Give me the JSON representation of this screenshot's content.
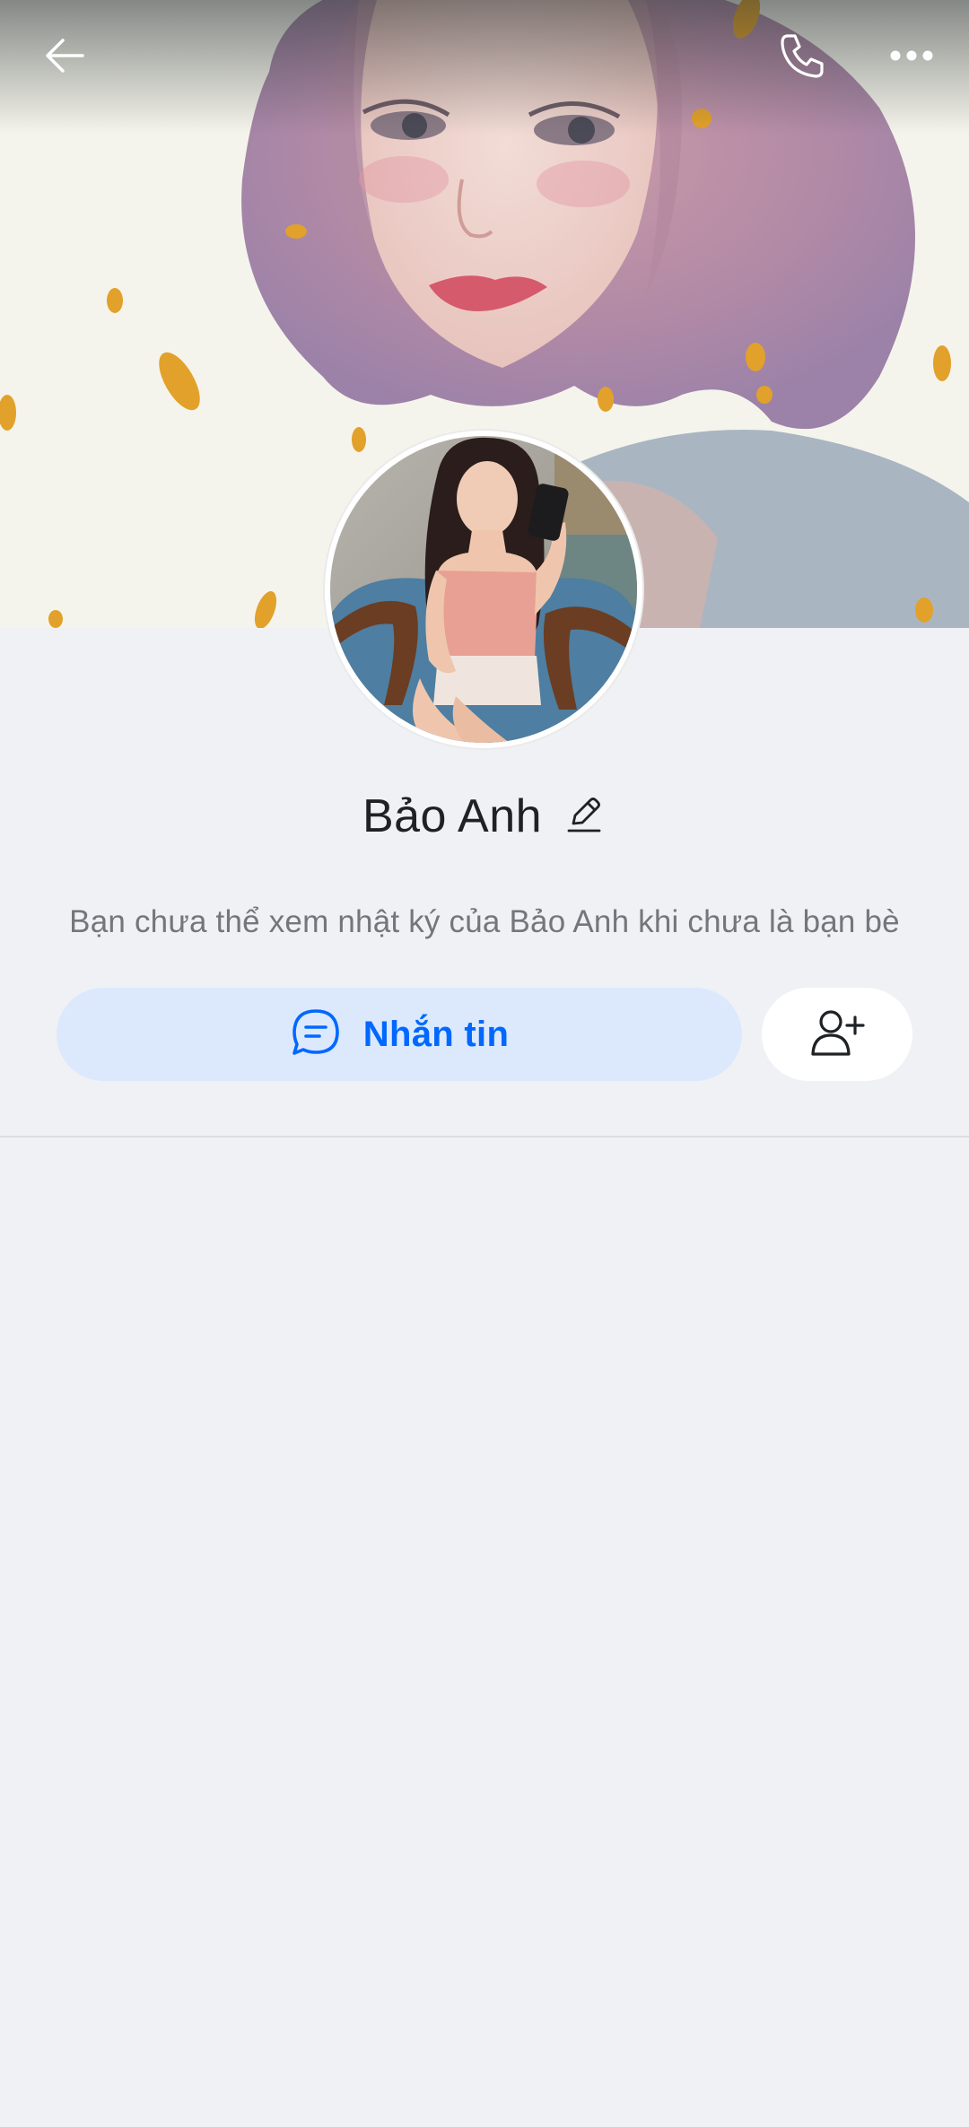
{
  "header": {
    "back_icon": "arrow-left-icon",
    "call_icon": "phone-icon",
    "more_icon": "more-dots-icon"
  },
  "profile": {
    "name": "Bảo Anh",
    "edit_icon": "pencil-icon",
    "cover_image": "illustrated-woman-with-pink-hair",
    "avatar_image": "woman-selfie-in-chair"
  },
  "diary": {
    "notice": "Bạn chưa thể xem nhật ký của Bảo Anh khi chưa là bạn bè"
  },
  "actions": {
    "message_label": "Nhắn tin",
    "message_icon": "chat-bubble-icon",
    "add_friend_icon": "add-friend-icon"
  },
  "colors": {
    "accent": "#0068ff",
    "message_button_bg": "#dce9fd",
    "page_bg": "#f0f1f5",
    "muted_text": "#72777d"
  }
}
